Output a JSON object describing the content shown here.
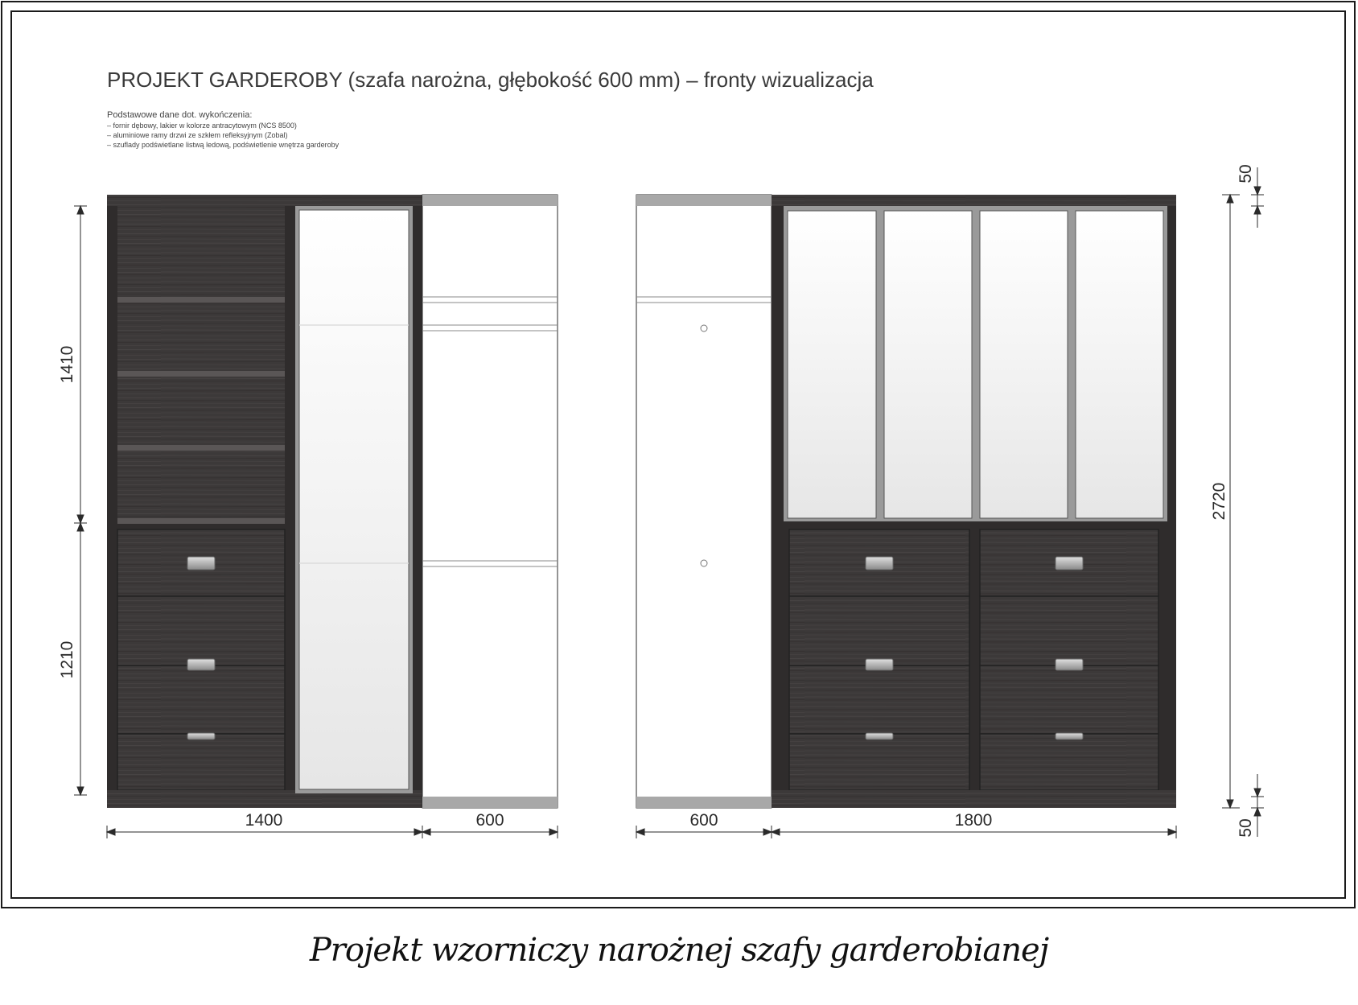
{
  "title": "PROJEKT GARDEROBY (szafa narożna, głębokość 600 mm) – fronty wizualizacja",
  "notes": {
    "heading": "Podstawowe dane dot. wykończenia:",
    "items": [
      "– fornir dębowy, lakier w kolorze antracytowym (NCS 8500)",
      "– aluminiowe ramy drzwi ze szkłem refleksyjnym (Zobal)",
      "– szuflady podświetlane listwą ledową, podświetlenie wnętrza garderoby"
    ]
  },
  "dimensions": {
    "left_width_main": "1400",
    "left_width_side": "600",
    "right_width_side": "600",
    "right_width_main": "1800",
    "upper_height": "1410",
    "lower_height": "1210",
    "total_height": "2720",
    "top_plinth": "50",
    "bottom_plinth": "50"
  },
  "colors": {
    "wood": "#3c3939",
    "wood_dark": "#2a2828",
    "aluminium": "#9a9a9a",
    "mirror": "#f4f4f4",
    "line": "#2a2a2a"
  },
  "caption": "Projekt wzorniczy narożnej szafy garderobianej"
}
